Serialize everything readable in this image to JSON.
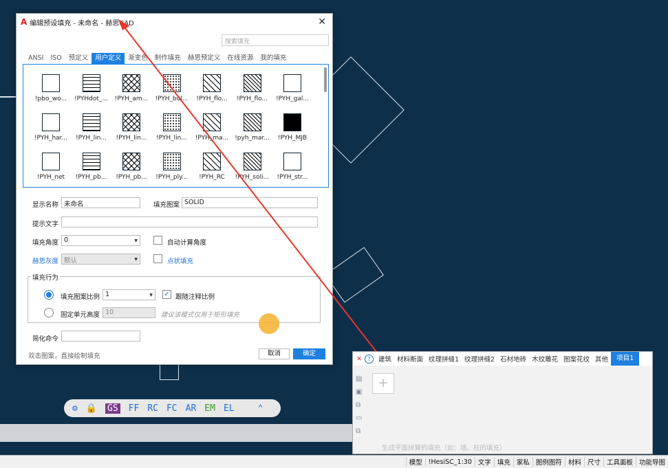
{
  "dialog": {
    "title": "编辑预设填充 - 未命名 - 赫思CAD",
    "search_placeholder": "搜索填充",
    "tabs": [
      {
        "label": "ANSI",
        "active": false
      },
      {
        "label": "ISO",
        "active": false
      },
      {
        "label": "预定义",
        "active": false
      },
      {
        "label": "用户定义",
        "active": true
      },
      {
        "label": "渐变色",
        "active": false
      },
      {
        "label": "制作填充",
        "active": false
      },
      {
        "label": "赫思预定义",
        "active": false
      },
      {
        "label": "在线资源",
        "active": false
      },
      {
        "label": "我的填充",
        "active": false
      }
    ],
    "patterns": [
      "!pbo_wo...",
      "!PYHdot_...",
      "!PYH_am...",
      "!PYH_bul...",
      "!PYH_flo...",
      "!PYH_flo...",
      "!PYH_gal...",
      "!PYH_har...",
      "!PYH_lin...",
      "!PYH_lin...",
      "!PYH_lin...",
      "!PYH_ma...",
      "!pyh_mar...",
      "!PYH_MJB",
      "!PYH_net",
      "!PYH_pb...",
      "!PYH_pb...",
      "!PYH_ply...",
      "!PYH_RC",
      "!PYH_soli...",
      "!PYH_str..."
    ],
    "display_name_label": "显示名称",
    "display_name_value": "未命名",
    "fill_pattern_label": "填充图案",
    "fill_pattern_value": "SOLID",
    "hint_text_label": "提示文字",
    "hint_text_value": "",
    "fill_angle_label": "填充角度",
    "fill_angle_value": "0",
    "auto_angle_label": "自动计算角度",
    "gray_label": "赫思灰度",
    "gray_value": "默认",
    "dot_fill_label": "点状填充",
    "fill_behavior_label": "填充行为",
    "scale_label": "填充图案比例",
    "scale_value": "1",
    "follow_annotation_label": "跟随注释比例",
    "fixed_height_label": "固定单元高度",
    "fixed_height_value": "10",
    "fixed_height_hint": "建议该模式仅用于矩形填充",
    "short_cmd_label": "简化命令",
    "short_cmd_value": "",
    "footer_hint": "双击图案，直接绘制填充",
    "cancel_label": "取消",
    "ok_label": "确定"
  },
  "quick_toolbar": [
    "GS",
    "FF",
    "RC",
    "FC",
    "AR",
    "EM",
    "EL"
  ],
  "panel": {
    "tabs": [
      "建筑",
      "材料断面",
      "纹理拼缝1",
      "纹理拼缝2",
      "石材地砖",
      "木纹雕花",
      "图案花纹",
      "其他"
    ],
    "active_tab": "项目1",
    "add_symbol": "+",
    "bottom_hint": "生成平面拼算的填充（如：墙、柱的填充）"
  },
  "statusbar": [
    "模型",
    "!HesiSC_1:30",
    "文字",
    "填充",
    "家私",
    "图例图符",
    "材料",
    "尺寸",
    "工具面板",
    "功能导图"
  ],
  "colors": {
    "accent": "#1e80e0",
    "canvas": "#0e2f4a",
    "arrow": "#e8352a"
  }
}
